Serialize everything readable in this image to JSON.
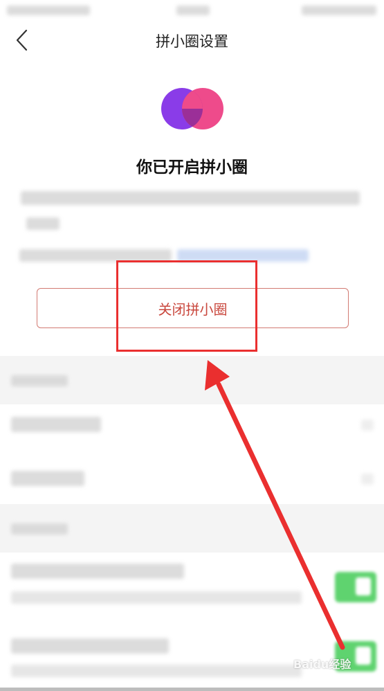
{
  "nav": {
    "title": "拼小圈设置",
    "back_icon": "chevron-left-icon"
  },
  "status": {
    "headline": "你已开启拼小圈"
  },
  "actions": {
    "close_label": "关闭拼小圈"
  },
  "watermark": {
    "text": "Baidu经验"
  },
  "colors": {
    "logo_left": "#8a3ce8",
    "logo_right": "#ee4b8b",
    "logo_overlap": "#9b2f98",
    "button_text": "#c9473d",
    "annotation": "#ea2f2f",
    "toggle_on": "#5fd36f"
  }
}
